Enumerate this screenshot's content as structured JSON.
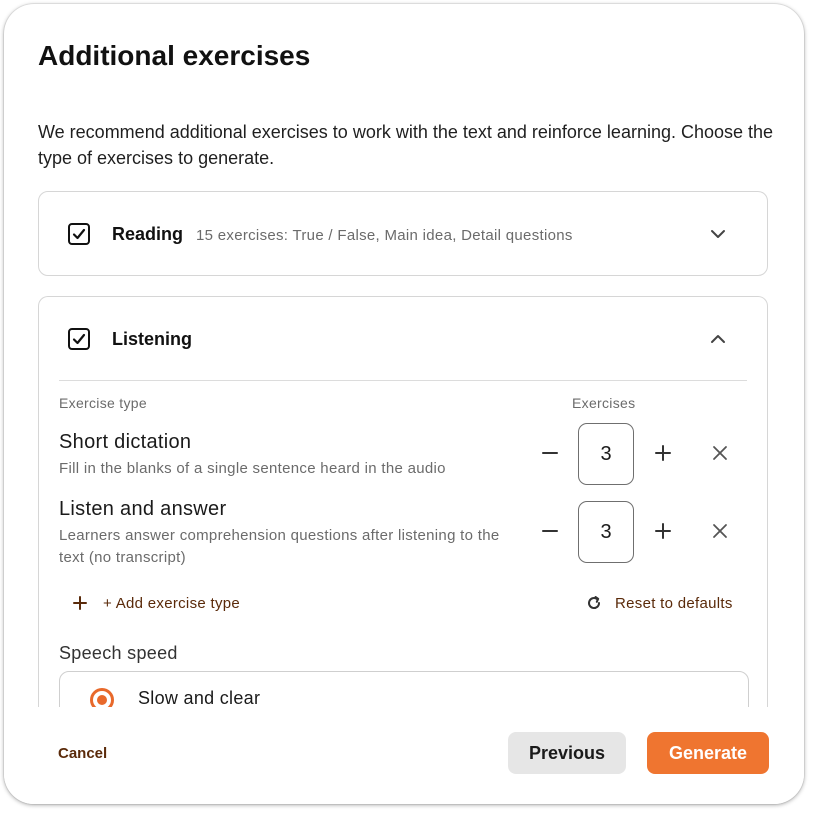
{
  "dialog": {
    "title": "Additional exercises",
    "intro": "We recommend additional exercises to work with the text and reinforce learning. Choose the type of exercises to generate."
  },
  "reading": {
    "label": "Reading",
    "summary": "15 exercises: True / False, Main idea, Detail questions",
    "checked": true,
    "expanded": false
  },
  "listening": {
    "label": "Listening",
    "checked": true,
    "expanded": true,
    "column_exercise_type": "Exercise type",
    "column_exercises": "Exercises",
    "exercises": [
      {
        "title": "Short dictation",
        "description": "Fill in the blanks of a single sentence heard in the audio",
        "count": "3"
      },
      {
        "title": "Listen and answer",
        "description": "Learners answer comprehension questions after listening to the text (no transcript)",
        "count": "3"
      }
    ],
    "add_exercise_type": "+ Add exercise type",
    "reset_defaults": "Reset to defaults",
    "speech_speed_label": "Speech speed",
    "speech_speed_selected": "Slow and clear"
  },
  "footer": {
    "cancel": "Cancel",
    "previous": "Previous",
    "generate": "Generate"
  },
  "colors": {
    "accent": "#ef7530",
    "link": "#5a2a0a",
    "secondary_button": "#e6e6e6"
  },
  "icons": [
    "check-icon",
    "chevron-down-icon",
    "chevron-up-icon",
    "minus-icon",
    "plus-icon",
    "close-icon",
    "refresh-icon",
    "radio-selected-icon"
  ]
}
